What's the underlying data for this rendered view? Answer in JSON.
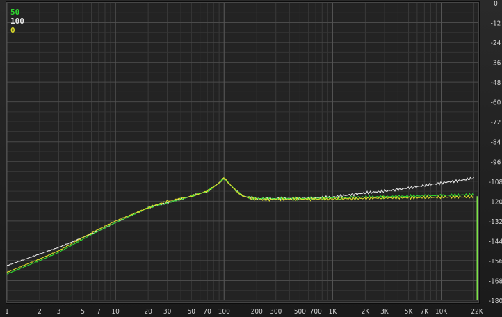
{
  "chart_data": {
    "type": "line",
    "xscale": "log",
    "xlim": [
      1,
      22000
    ],
    "ylim": [
      -180,
      0
    ],
    "grid": true,
    "legend_placement": "top-left",
    "x_tick_labels": [
      {
        "v": 1,
        "label": "1"
      },
      {
        "v": 2,
        "label": "2"
      },
      {
        "v": 3,
        "label": "3"
      },
      {
        "v": 5,
        "label": "5"
      },
      {
        "v": 7,
        "label": "7"
      },
      {
        "v": 10,
        "label": "10"
      },
      {
        "v": 20,
        "label": "20"
      },
      {
        "v": 30,
        "label": "30"
      },
      {
        "v": 50,
        "label": "50"
      },
      {
        "v": 70,
        "label": "70"
      },
      {
        "v": 100,
        "label": "100"
      },
      {
        "v": 200,
        "label": "200"
      },
      {
        "v": 300,
        "label": "300"
      },
      {
        "v": 500,
        "label": "500"
      },
      {
        "v": 700,
        "label": "700"
      },
      {
        "v": 1000,
        "label": "1K"
      },
      {
        "v": 2000,
        "label": "2K"
      },
      {
        "v": 3000,
        "label": "3K"
      },
      {
        "v": 5000,
        "label": "5K"
      },
      {
        "v": 7000,
        "label": "7K"
      },
      {
        "v": 10000,
        "label": "10K"
      },
      {
        "v": 22000,
        "label": "22K"
      }
    ],
    "y_tick_labels": [
      "0",
      "-12",
      "-24",
      "-36",
      "-48",
      "-60",
      "-72",
      "-84",
      "-96",
      "-108",
      "-120",
      "-132",
      "-144",
      "-156",
      "-168",
      "-180"
    ],
    "x": [
      1,
      2,
      3,
      5,
      7,
      10,
      20,
      30,
      50,
      70,
      90,
      100,
      110,
      130,
      150,
      200,
      300,
      500,
      700,
      1000,
      2000,
      3000,
      5000,
      7000,
      10000,
      15000,
      20000
    ],
    "series": [
      {
        "name": "50",
        "color": "#2fd82f",
        "values": [
          -164,
          -156,
          -151,
          -143,
          -138,
          -133,
          -124,
          -121,
          -117,
          -114,
          -109,
          -106,
          -109,
          -114,
          -117,
          -118.5,
          -118.5,
          -118.5,
          -118.3,
          -118,
          -117.5,
          -117.3,
          -117,
          -116.8,
          -116.5,
          -116.3,
          -116
        ]
      },
      {
        "name": "100",
        "color": "#e6e6e6",
        "values": [
          -159,
          -152,
          -148,
          -142,
          -138,
          -133,
          -124,
          -121,
          -117,
          -114,
          -109,
          -106,
          -109,
          -114,
          -117,
          -118.5,
          -118.5,
          -118.3,
          -118,
          -117.5,
          -115,
          -114,
          -112,
          -110.5,
          -109,
          -107.5,
          -106
        ]
      },
      {
        "name": "0",
        "color": "#dada2a",
        "values": [
          -163,
          -155,
          -150,
          -142,
          -137,
          -132,
          -124,
          -120,
          -117,
          -114,
          -109,
          -106,
          -109,
          -114,
          -117,
          -119,
          -119,
          -118.8,
          -118.7,
          -118.6,
          -118.3,
          -118,
          -117.9,
          -117.8,
          -117.6,
          -117.5,
          -117.4
        ]
      }
    ]
  }
}
